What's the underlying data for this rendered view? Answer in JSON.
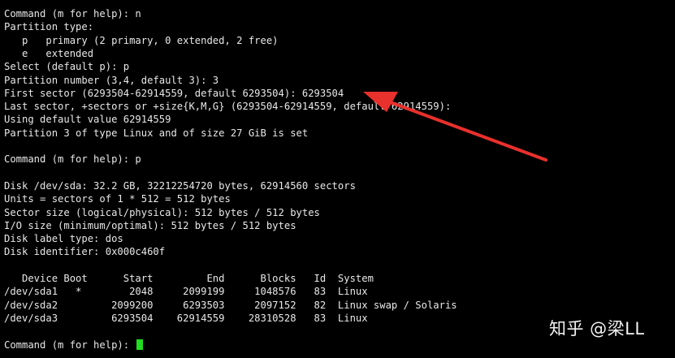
{
  "terminal": {
    "lines": [
      "Command (m for help): n",
      "Partition type:",
      "   p   primary (2 primary, 0 extended, 2 free)",
      "   e   extended",
      "Select (default p): p",
      "Partition number (3,4, default 3): 3",
      "First sector (6293504-62914559, default 6293504): 6293504",
      "Last sector, +sectors or +size{K,M,G} (6293504-62914559, default 62914559):",
      "Using default value 62914559",
      "Partition 3 of type Linux and of size 27 GiB is set",
      "",
      "Command (m for help): p",
      "",
      "Disk /dev/sda: 32.2 GB, 32212254720 bytes, 62914560 sectors",
      "Units = sectors of 1 * 512 = 512 bytes",
      "Sector size (logical/physical): 512 bytes / 512 bytes",
      "I/O size (minimum/optimal): 512 bytes / 512 bytes",
      "Disk label type: dos",
      "Disk identifier: 0x000c460f",
      "",
      "   Device Boot      Start         End      Blocks   Id  System",
      "/dev/sda1   *        2048     2099199     1048576   83  Linux",
      "/dev/sda2         2099200     6293503     2097152   82  Linux swap / Solaris",
      "/dev/sda3         6293504    62914559    28310528   83  Linux",
      "",
      "Command (m for help): "
    ],
    "cursor_color": "#22dd22",
    "text_color": "#e8e8e8",
    "background_color": "#000000"
  },
  "annotation": {
    "arrow_color": "#e8302c"
  },
  "watermark": {
    "text": "知乎 @梁LL"
  }
}
